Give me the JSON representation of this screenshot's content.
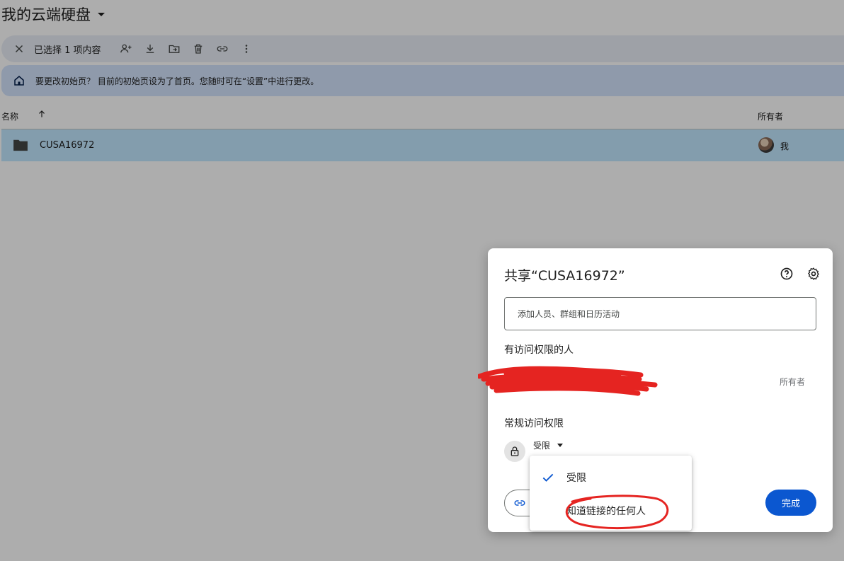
{
  "header": {
    "title": "我的云端硬盘"
  },
  "selection_toolbar": {
    "count_label": "已选择 1 项内容",
    "icons": [
      "close-icon",
      "share-person-add-icon",
      "download-icon",
      "move-folder-icon",
      "trash-icon",
      "link-icon",
      "more-vert-icon"
    ]
  },
  "banner": {
    "text": "要更改初始页？ 目前的初始页设为了首页。您随时可在“设置”中进行更改。"
  },
  "list": {
    "col_name": "名称",
    "col_owner": "所有者",
    "rows": [
      {
        "name": "CUSA16972",
        "owner": "我"
      }
    ]
  },
  "share_dialog": {
    "title": "共享“CUSA16972”",
    "add_placeholder": "添加人员、群组和日历活动",
    "people_section": "有访问权限的人",
    "owner_role": "所有者",
    "general_access_section": "常规访问权限",
    "access_value": "受限",
    "done_label": "完成"
  },
  "access_menu": {
    "options": [
      {
        "label": "受限",
        "selected": true
      },
      {
        "label": "知道链接的任何人",
        "selected": false
      }
    ]
  },
  "colors": {
    "accent": "#0b57d0",
    "selected_row": "#c2e7ff",
    "banner": "#d3e3fd",
    "annotation_red": "#e52421"
  }
}
